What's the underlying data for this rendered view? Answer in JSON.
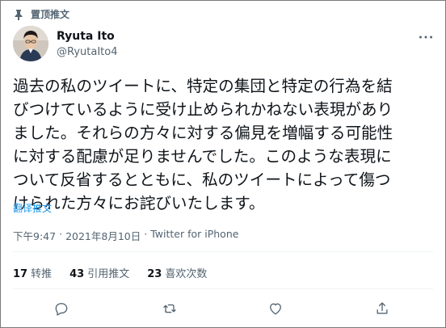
{
  "pinned": {
    "label": "置顶推文",
    "icon": "pin-icon"
  },
  "author": {
    "name": "Ryuta Ito",
    "handle": "@RyutaIto4",
    "avatar": "avatar-photo"
  },
  "tweet": {
    "text": "過去の私のツイートに、特定の集団と特定の行為を結\nびつけているように受け止められかねない表現があり\nました。それらの方々に対する偏見を増幅する可能性\nに対する配慮が足りませんでした。このような表現に\nついて反省するとともに、私のツイートによって傷つ\nけられた方々にお詫びいたします。",
    "translate_label": "翻译推文",
    "time": "下午9:47",
    "date": "2021年8月10日",
    "separator": "·",
    "client": "Twitter for iPhone"
  },
  "stats": {
    "retweets_count": "17",
    "retweets_label": "转推",
    "quotes_count": "43",
    "quotes_label": "引用推文",
    "likes_count": "23",
    "likes_label": "喜欢次数"
  },
  "actions": {
    "reply_icon": "reply-icon",
    "retweet_icon": "retweet-icon",
    "like_icon": "heart-icon",
    "share_icon": "share-icon"
  },
  "colors": {
    "text": "#0f1419",
    "secondary": "#536471",
    "link": "#1d9bf0",
    "divider": "#eff3f4"
  }
}
